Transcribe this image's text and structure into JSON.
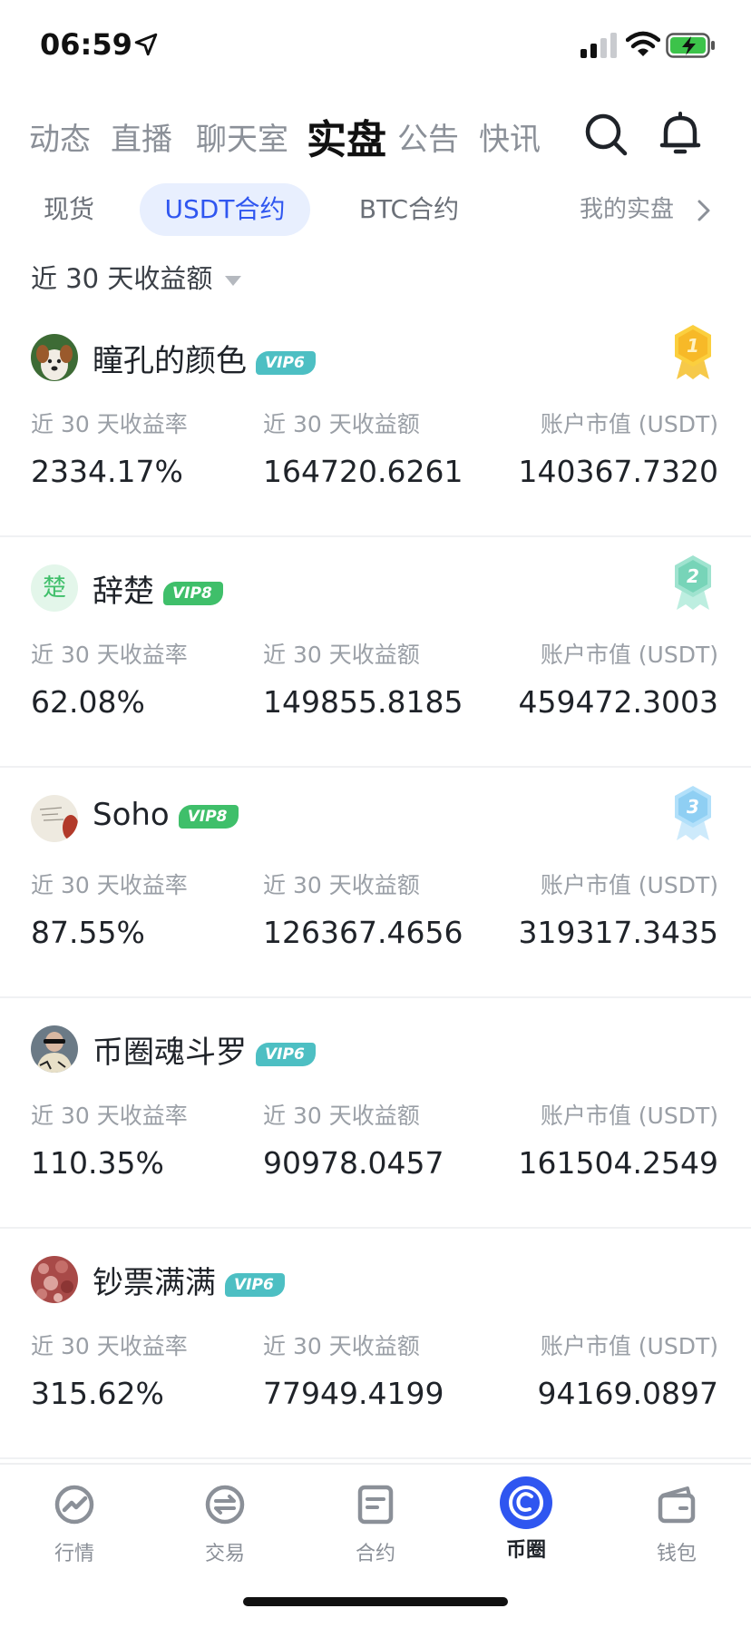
{
  "status_bar": {
    "time": "06:59"
  },
  "top_nav": {
    "tabs": [
      "动态",
      "直播",
      "聊天室",
      "实盘",
      "公告",
      "快讯"
    ],
    "active_index": 3
  },
  "sub_tabs": {
    "tabs": [
      "现货",
      "USDT合约",
      "BTC合约"
    ],
    "active_index": 1,
    "right_link": "我的实盘"
  },
  "sort": {
    "label": "近 30 天收益额"
  },
  "column_labels": {
    "rate": "近 30 天收益率",
    "amount": "近 30 天收益额",
    "market_value": "账户市值 (USDT)"
  },
  "traders": [
    {
      "name": "瞳孔的颜色",
      "vip": "VIP6",
      "vip_color": "#4dbfc3",
      "medal": "1",
      "rate": "2334.17%",
      "amount": "164720.6261",
      "market_value": "140367.7320"
    },
    {
      "name": "辞楚",
      "avatar_text": "楚",
      "vip": "VIP8",
      "vip_color": "#3fbf6a",
      "medal": "2",
      "rate": "62.08%",
      "amount": "149855.8185",
      "market_value": "459472.3003"
    },
    {
      "name": "Soho",
      "vip": "VIP8",
      "vip_color": "#3fbf6a",
      "medal": "3",
      "rate": "87.55%",
      "amount": "126367.4656",
      "market_value": "319317.3435"
    },
    {
      "name": "币圈魂斗罗",
      "vip": "VIP6",
      "vip_color": "#4dbfc3",
      "rate": "110.35%",
      "amount": "90978.0457",
      "market_value": "161504.2549"
    },
    {
      "name": "钞票满满",
      "vip": "VIP6",
      "vip_color": "#4dbfc3",
      "rate": "315.62%",
      "amount": "77949.4199",
      "market_value": "94169.0897"
    }
  ],
  "tab_bar": {
    "items": [
      "行情",
      "交易",
      "合约",
      "币圈",
      "钱包"
    ],
    "active_index": 3,
    "accent": "#2f56f0"
  }
}
